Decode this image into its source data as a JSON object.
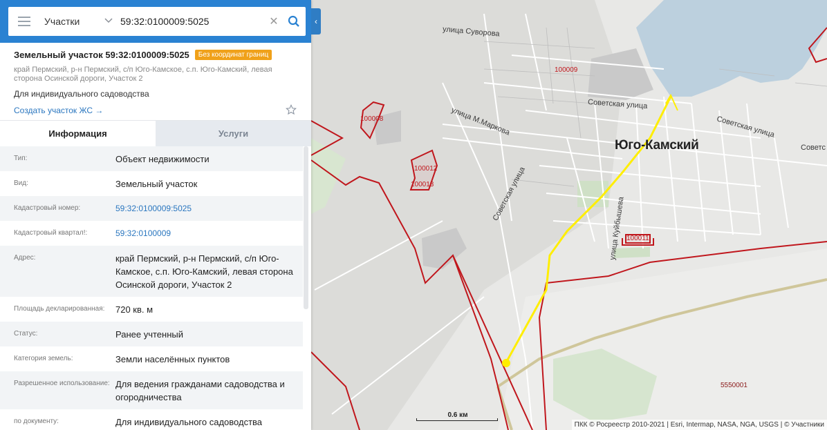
{
  "search": {
    "type": "Участки",
    "query": "59:32:0100009:5025"
  },
  "plot": {
    "title": "Земельный участок 59:32:0100009:5025",
    "badge": "Без координат границ",
    "address_short": "край Пермский, р-н Пермский, с/п Юго-Камское, с.п. Юго-Камский, левая сторона Осинской дороги, Участок 2",
    "purpose": "Для индивидуального садоводства",
    "create_link": "Создать участок ЖС →"
  },
  "tabs": [
    {
      "label": "Информация",
      "active": true
    },
    {
      "label": "Услуги",
      "active": false
    }
  ],
  "info": [
    {
      "key": "Тип:",
      "value": "Объект недвижимости"
    },
    {
      "key": "Вид:",
      "value": "Земельный участок"
    },
    {
      "key": "Кадастровый номер:",
      "value": "59:32:0100009:5025"
    },
    {
      "key": "Кадастровый квартал!:",
      "value": "59:32:0100009"
    },
    {
      "key": "Адрес:",
      "value": "край Пермский, р-н Пермский, с/п Юго-Камское, с.п. Юго-Камский, левая сторона Осинской дороги, Участок 2"
    },
    {
      "key": "Площадь декларированная:",
      "value": "720 кв. м"
    },
    {
      "key": "Статус:",
      "value": "Ранее учтенный"
    },
    {
      "key": "Категория земель:",
      "value": "Земли населённых пунктов"
    },
    {
      "key": "Разрешенное использование:",
      "value": "Для ведения гражданами садоводства и огородничества"
    },
    {
      "key": "по документу:",
      "value": "Для индивидуального садоводства"
    }
  ],
  "map": {
    "city_label": "Юго-Камский",
    "streets": {
      "suvorova": "улица Суворова",
      "sovetskaya1": "Советская улица",
      "sovetskaya2": "Советская улица",
      "sovetskaya3": "Советс",
      "markova": "улица М.Маркова",
      "sovetskaya_vert": "Советская улица",
      "kuibysheva": "улица Куйбышева"
    },
    "quarters": {
      "q100009": "100009",
      "q100008": "100008",
      "q100012": "100012",
      "q100013": "100013",
      "q100011": "100011",
      "q5550001": "5550001"
    },
    "scale_label": "0.6 км",
    "attribution": "ПКК © Росреестр 2010-2021 | Esri, Intermap, NASA, NGA, USGS | © Участники"
  },
  "colors": {
    "panel_blue": "#2a82d2",
    "boundary_red": "#c0161c",
    "route_yellow": "#ffee00",
    "water": "#bcd0de",
    "badge_orange": "#f0a11a"
  }
}
